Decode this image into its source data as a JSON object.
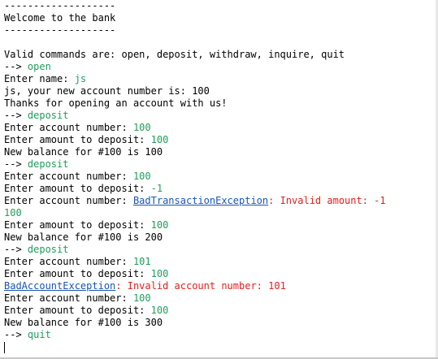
{
  "lines": [
    [
      {
        "t": "-------------------",
        "s": "plain"
      }
    ],
    [
      {
        "t": "Welcome to the bank",
        "s": "plain"
      }
    ],
    [
      {
        "t": "-------------------",
        "s": "plain"
      }
    ],
    [
      {
        "t": "",
        "s": "plain"
      }
    ],
    [
      {
        "t": "Valid commands are: open, deposit, withdraw, inquire, quit",
        "s": "plain"
      }
    ],
    [
      {
        "t": "--> ",
        "s": "plain"
      },
      {
        "t": "open",
        "s": "input"
      }
    ],
    [
      {
        "t": "Enter name: ",
        "s": "plain"
      },
      {
        "t": "js",
        "s": "input"
      }
    ],
    [
      {
        "t": "js, your new account number is: 100",
        "s": "plain"
      }
    ],
    [
      {
        "t": "Thanks for opening an account with us!",
        "s": "plain"
      }
    ],
    [
      {
        "t": "--> ",
        "s": "plain"
      },
      {
        "t": "deposit",
        "s": "input"
      }
    ],
    [
      {
        "t": "Enter account number: ",
        "s": "plain"
      },
      {
        "t": "100",
        "s": "input"
      }
    ],
    [
      {
        "t": "Enter amount to deposit: ",
        "s": "plain"
      },
      {
        "t": "100",
        "s": "input"
      }
    ],
    [
      {
        "t": "New balance for #100 is 100",
        "s": "plain"
      }
    ],
    [
      {
        "t": "--> ",
        "s": "plain"
      },
      {
        "t": "deposit",
        "s": "input"
      }
    ],
    [
      {
        "t": "Enter account number: ",
        "s": "plain"
      },
      {
        "t": "100",
        "s": "input"
      }
    ],
    [
      {
        "t": "Enter amount to deposit: ",
        "s": "plain"
      },
      {
        "t": "-1",
        "s": "input"
      }
    ],
    [
      {
        "t": "Enter account number: ",
        "s": "plain"
      },
      {
        "t": "BadTransactionException",
        "s": "link"
      },
      {
        "t": ": Invalid amount: -1",
        "s": "error"
      }
    ],
    [
      {
        "t": "100",
        "s": "input"
      }
    ],
    [
      {
        "t": "Enter amount to deposit: ",
        "s": "plain"
      },
      {
        "t": "100",
        "s": "input"
      }
    ],
    [
      {
        "t": "New balance for #100 is 200",
        "s": "plain"
      }
    ],
    [
      {
        "t": "--> ",
        "s": "plain"
      },
      {
        "t": "deposit",
        "s": "input"
      }
    ],
    [
      {
        "t": "Enter account number: ",
        "s": "plain"
      },
      {
        "t": "101",
        "s": "input"
      }
    ],
    [
      {
        "t": "Enter amount to deposit: ",
        "s": "plain"
      },
      {
        "t": "100",
        "s": "input"
      }
    ],
    [
      {
        "t": "BadAccountException",
        "s": "link"
      },
      {
        "t": ": Invalid account number: 101",
        "s": "error"
      }
    ],
    [
      {
        "t": "Enter account number: ",
        "s": "plain"
      },
      {
        "t": "100",
        "s": "input"
      }
    ],
    [
      {
        "t": "Enter amount to deposit: ",
        "s": "plain"
      },
      {
        "t": "100",
        "s": "input"
      }
    ],
    [
      {
        "t": "New balance for #100 is 300",
        "s": "plain"
      }
    ],
    [
      {
        "t": "--> ",
        "s": "plain"
      },
      {
        "t": "quit",
        "s": "input"
      }
    ]
  ],
  "colors": {
    "input": "#1f9e5a",
    "error": "#e02020",
    "link": "#1a55b5"
  }
}
